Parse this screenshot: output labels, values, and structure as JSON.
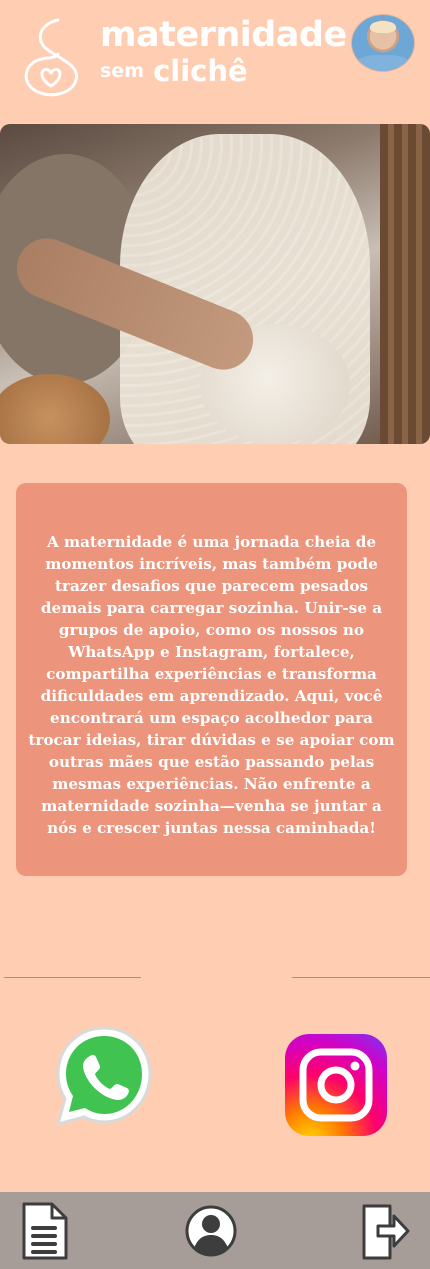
{
  "header": {
    "logo_line1": "maternidade",
    "logo_sem": "sem",
    "logo_cliche": "clichê",
    "avatar_icon": "user-avatar"
  },
  "hero": {
    "image": "pregnant-couple-photo"
  },
  "intro": {
    "text": "A maternidade é uma jornada cheia de momentos incríveis, mas também pode trazer desafios que parecem pesados demais para carregar sozinha. Unir-se a grupos de apoio, como os nossos no WhatsApp e Instagram, fortalece, compartilha experiências e transforma dificuldades em aprendizado. Aqui, você encontrará um espaço acolhedor para trocar ideias, tirar dúvidas e se apoiar com outras mães que estão passando pelas mesmas experiências. Não enfrente a maternidade sozinha—venha se juntar a nós e crescer juntas nessa caminhada!"
  },
  "social": {
    "whatsapp_icon": "whatsapp-icon",
    "instagram_icon": "instagram-icon"
  },
  "nav": {
    "items": [
      "document-icon",
      "profile-icon",
      "logout-icon"
    ]
  },
  "colors": {
    "background": "#ffcdb2",
    "card": "#ec957c",
    "nav": "#a69d98",
    "whatsapp": "#40c351",
    "text_on_card": "#ffffff"
  }
}
